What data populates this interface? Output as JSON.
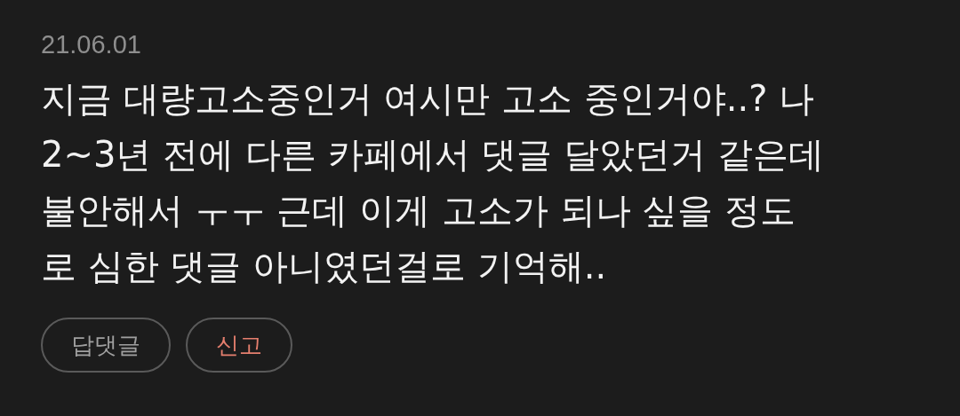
{
  "comment": {
    "date": "21.06.01",
    "text": "지금 대량고소중인거 여시만 고소 중인거야..? 나\n2~3년 전에 다른 카페에서 댓글 달았던거 같은데\n불안해서 ㅜㅜ 근데 이게 고소가 되나 싶을 정도\n로 심한 댓글 아니였던걸로 기억해..",
    "actions": [
      {
        "label": "답댓글",
        "kind": "reply"
      },
      {
        "label": "신고",
        "kind": "report"
      }
    ]
  }
}
